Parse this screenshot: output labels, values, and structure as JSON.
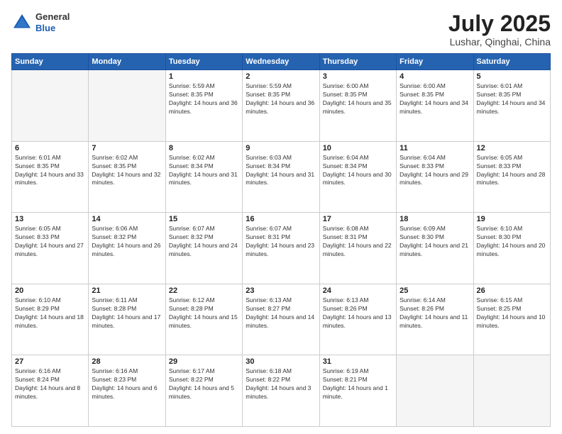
{
  "header": {
    "logo": {
      "general": "General",
      "blue": "Blue"
    },
    "title": "July 2025",
    "subtitle": "Lushar, Qinghai, China"
  },
  "weekdays": [
    "Sunday",
    "Monday",
    "Tuesday",
    "Wednesday",
    "Thursday",
    "Friday",
    "Saturday"
  ],
  "weeks": [
    [
      {
        "day": "",
        "empty": true
      },
      {
        "day": "",
        "empty": true
      },
      {
        "day": "1",
        "sunrise": "Sunrise: 5:59 AM",
        "sunset": "Sunset: 8:35 PM",
        "daylight": "Daylight: 14 hours and 36 minutes."
      },
      {
        "day": "2",
        "sunrise": "Sunrise: 5:59 AM",
        "sunset": "Sunset: 8:35 PM",
        "daylight": "Daylight: 14 hours and 36 minutes."
      },
      {
        "day": "3",
        "sunrise": "Sunrise: 6:00 AM",
        "sunset": "Sunset: 8:35 PM",
        "daylight": "Daylight: 14 hours and 35 minutes."
      },
      {
        "day": "4",
        "sunrise": "Sunrise: 6:00 AM",
        "sunset": "Sunset: 8:35 PM",
        "daylight": "Daylight: 14 hours and 34 minutes."
      },
      {
        "day": "5",
        "sunrise": "Sunrise: 6:01 AM",
        "sunset": "Sunset: 8:35 PM",
        "daylight": "Daylight: 14 hours and 34 minutes."
      }
    ],
    [
      {
        "day": "6",
        "sunrise": "Sunrise: 6:01 AM",
        "sunset": "Sunset: 8:35 PM",
        "daylight": "Daylight: 14 hours and 33 minutes."
      },
      {
        "day": "7",
        "sunrise": "Sunrise: 6:02 AM",
        "sunset": "Sunset: 8:35 PM",
        "daylight": "Daylight: 14 hours and 32 minutes."
      },
      {
        "day": "8",
        "sunrise": "Sunrise: 6:02 AM",
        "sunset": "Sunset: 8:34 PM",
        "daylight": "Daylight: 14 hours and 31 minutes."
      },
      {
        "day": "9",
        "sunrise": "Sunrise: 6:03 AM",
        "sunset": "Sunset: 8:34 PM",
        "daylight": "Daylight: 14 hours and 31 minutes."
      },
      {
        "day": "10",
        "sunrise": "Sunrise: 6:04 AM",
        "sunset": "Sunset: 8:34 PM",
        "daylight": "Daylight: 14 hours and 30 minutes."
      },
      {
        "day": "11",
        "sunrise": "Sunrise: 6:04 AM",
        "sunset": "Sunset: 8:33 PM",
        "daylight": "Daylight: 14 hours and 29 minutes."
      },
      {
        "day": "12",
        "sunrise": "Sunrise: 6:05 AM",
        "sunset": "Sunset: 8:33 PM",
        "daylight": "Daylight: 14 hours and 28 minutes."
      }
    ],
    [
      {
        "day": "13",
        "sunrise": "Sunrise: 6:05 AM",
        "sunset": "Sunset: 8:33 PM",
        "daylight": "Daylight: 14 hours and 27 minutes."
      },
      {
        "day": "14",
        "sunrise": "Sunrise: 6:06 AM",
        "sunset": "Sunset: 8:32 PM",
        "daylight": "Daylight: 14 hours and 26 minutes."
      },
      {
        "day": "15",
        "sunrise": "Sunrise: 6:07 AM",
        "sunset": "Sunset: 8:32 PM",
        "daylight": "Daylight: 14 hours and 24 minutes."
      },
      {
        "day": "16",
        "sunrise": "Sunrise: 6:07 AM",
        "sunset": "Sunset: 8:31 PM",
        "daylight": "Daylight: 14 hours and 23 minutes."
      },
      {
        "day": "17",
        "sunrise": "Sunrise: 6:08 AM",
        "sunset": "Sunset: 8:31 PM",
        "daylight": "Daylight: 14 hours and 22 minutes."
      },
      {
        "day": "18",
        "sunrise": "Sunrise: 6:09 AM",
        "sunset": "Sunset: 8:30 PM",
        "daylight": "Daylight: 14 hours and 21 minutes."
      },
      {
        "day": "19",
        "sunrise": "Sunrise: 6:10 AM",
        "sunset": "Sunset: 8:30 PM",
        "daylight": "Daylight: 14 hours and 20 minutes."
      }
    ],
    [
      {
        "day": "20",
        "sunrise": "Sunrise: 6:10 AM",
        "sunset": "Sunset: 8:29 PM",
        "daylight": "Daylight: 14 hours and 18 minutes."
      },
      {
        "day": "21",
        "sunrise": "Sunrise: 6:11 AM",
        "sunset": "Sunset: 8:28 PM",
        "daylight": "Daylight: 14 hours and 17 minutes."
      },
      {
        "day": "22",
        "sunrise": "Sunrise: 6:12 AM",
        "sunset": "Sunset: 8:28 PM",
        "daylight": "Daylight: 14 hours and 15 minutes."
      },
      {
        "day": "23",
        "sunrise": "Sunrise: 6:13 AM",
        "sunset": "Sunset: 8:27 PM",
        "daylight": "Daylight: 14 hours and 14 minutes."
      },
      {
        "day": "24",
        "sunrise": "Sunrise: 6:13 AM",
        "sunset": "Sunset: 8:26 PM",
        "daylight": "Daylight: 14 hours and 13 minutes."
      },
      {
        "day": "25",
        "sunrise": "Sunrise: 6:14 AM",
        "sunset": "Sunset: 8:26 PM",
        "daylight": "Daylight: 14 hours and 11 minutes."
      },
      {
        "day": "26",
        "sunrise": "Sunrise: 6:15 AM",
        "sunset": "Sunset: 8:25 PM",
        "daylight": "Daylight: 14 hours and 10 minutes."
      }
    ],
    [
      {
        "day": "27",
        "sunrise": "Sunrise: 6:16 AM",
        "sunset": "Sunset: 8:24 PM",
        "daylight": "Daylight: 14 hours and 8 minutes."
      },
      {
        "day": "28",
        "sunrise": "Sunrise: 6:16 AM",
        "sunset": "Sunset: 8:23 PM",
        "daylight": "Daylight: 14 hours and 6 minutes."
      },
      {
        "day": "29",
        "sunrise": "Sunrise: 6:17 AM",
        "sunset": "Sunset: 8:22 PM",
        "daylight": "Daylight: 14 hours and 5 minutes."
      },
      {
        "day": "30",
        "sunrise": "Sunrise: 6:18 AM",
        "sunset": "Sunset: 8:22 PM",
        "daylight": "Daylight: 14 hours and 3 minutes."
      },
      {
        "day": "31",
        "sunrise": "Sunrise: 6:19 AM",
        "sunset": "Sunset: 8:21 PM",
        "daylight": "Daylight: 14 hours and 1 minute."
      },
      {
        "day": "",
        "empty": true
      },
      {
        "day": "",
        "empty": true
      }
    ]
  ]
}
